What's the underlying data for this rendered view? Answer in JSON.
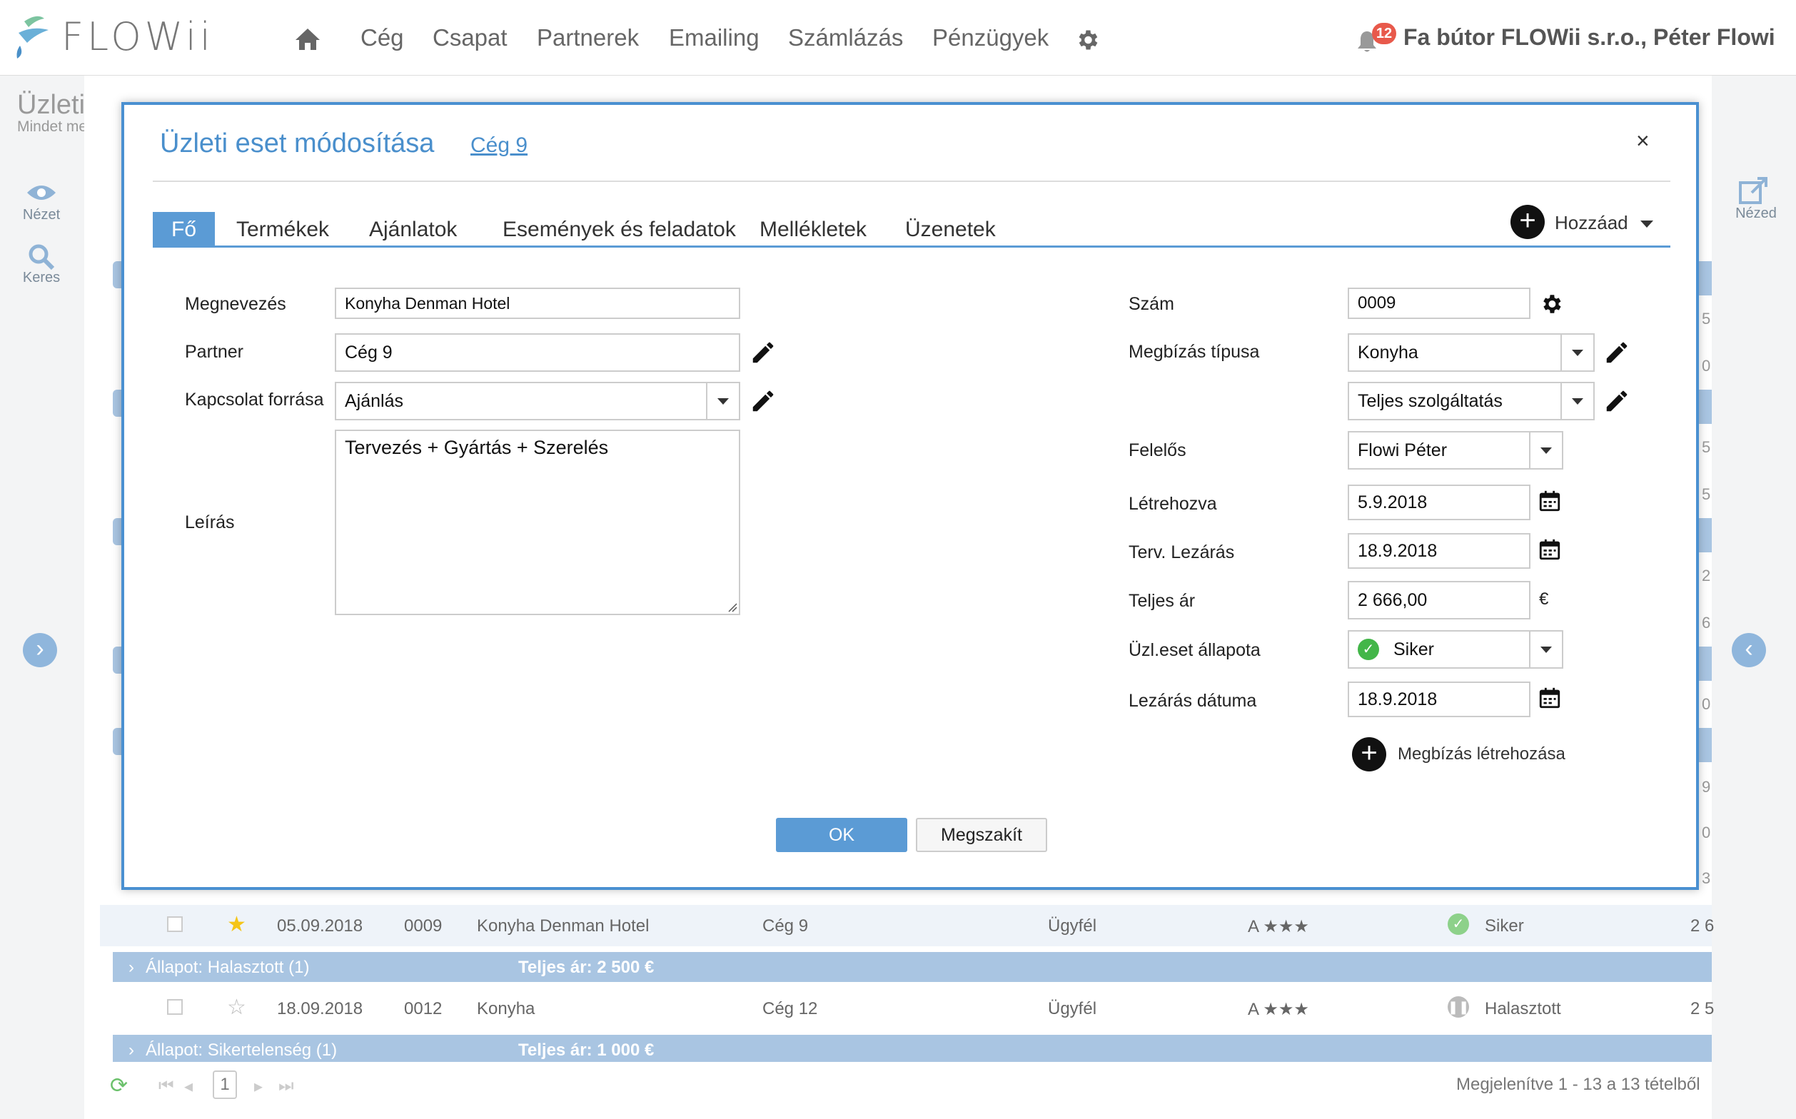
{
  "header": {
    "logo_text": "FLOWii",
    "nav": [
      "Cég",
      "Csapat",
      "Partnerek",
      "Emailing",
      "Számlázás",
      "Pénzügyek"
    ],
    "notification_count": "12",
    "company_user": "Fa bútor FLOWii s.r.o., Péter Flowi"
  },
  "background": {
    "page_title": "Üzleti esetek",
    "page_subtitle": "Mindet megjelenítése",
    "left_view": "Nézet",
    "left_search": "Keres",
    "right_view": "Nézed",
    "row1": {
      "date": "05.09.2018",
      "num": "0009",
      "name": "Konyha Denman Hotel",
      "partner": "Cég 9",
      "type": "Ügyfél",
      "rating": "A ★★★",
      "status": "Siker",
      "amount": "2 6"
    },
    "group1": {
      "label": "Állapot: Halasztott (1)",
      "total": "Teljes ár: 2 500 €"
    },
    "row2": {
      "date": "18.09.2018",
      "num": "0012",
      "name": "Konyha",
      "partner": "Cég 12",
      "type": "Ügyfél",
      "rating": "A ★★★",
      "status": "Halasztott",
      "amount": "2 5"
    },
    "group2": {
      "label": "Állapot: Sikertelenség (1)",
      "total": "Teljes ár: 1 000 €"
    },
    "pager_page": "1",
    "footer_text": "Megjelenítve 1 - 13 a 13 tételből",
    "edge_digits": [
      "5",
      "0",
      "5",
      "5",
      "2",
      "6",
      "0",
      "9",
      "0",
      "3"
    ]
  },
  "modal": {
    "title": "Üzleti eset módosítása",
    "link": "Cég 9",
    "close": "×",
    "tabs": [
      "Fő",
      "Termékek",
      "Ajánlatok",
      "Események és feladatok",
      "Mellékletek",
      "Üzenetek"
    ],
    "add_label": "Hozzáad",
    "left": {
      "name_label": "Megnevezés",
      "name_value": "Konyha Denman Hotel",
      "partner_label": "Partner",
      "partner_value": "Cég 9",
      "source_label": "Kapcsolat forrása",
      "source_value": "Ajánlás",
      "desc_label": "Leírás",
      "desc_value": "Tervezés + Gyártás + Szerelés"
    },
    "right": {
      "number_label": "Szám",
      "number_value": "0009",
      "order_type_label": "Megbízás típusa",
      "order_type_value": "Konyha",
      "order_subtype_value": "Teljes szolgáltatás",
      "owner_label": "Felelős",
      "owner_value": "Flowi Péter",
      "created_label": "Létrehozva",
      "created_value": "5.9.2018",
      "planned_close_label": "Terv. Lezárás",
      "planned_close_value": "18.9.2018",
      "price_label": "Teljes ár",
      "price_value": "2 666,00",
      "currency": "€",
      "status_label": "Üzl.eset állapota",
      "status_value": "Siker",
      "close_date_label": "Lezárás dátuma",
      "close_date_value": "18.9.2018",
      "create_order_label": "Megbízás létrehozása"
    },
    "ok_label": "OK",
    "cancel_label": "Megszakít"
  }
}
